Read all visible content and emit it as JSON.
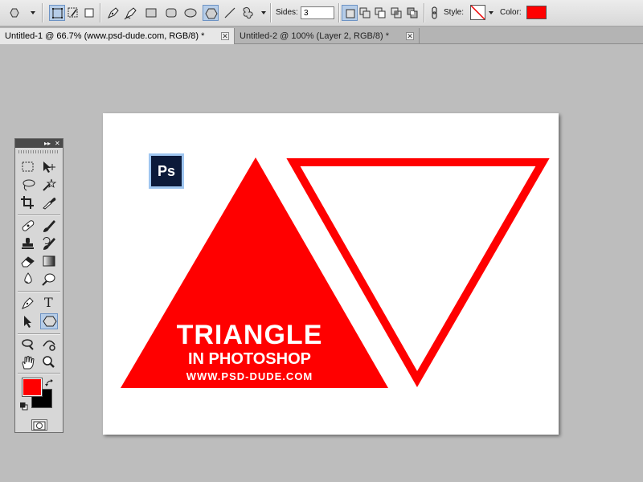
{
  "options_bar": {
    "sides_label": "Sides:",
    "sides_value": "3",
    "style_label": "Style:",
    "color_label": "Color:",
    "color_value": "#ff0000"
  },
  "tabs": [
    {
      "label": "Untitled-1 @ 66.7% (www.psd-dude.com, RGB/8) *",
      "active": true
    },
    {
      "label": "Untitled-2 @ 100% (Layer 2, RGB/8) *",
      "active": false
    }
  ],
  "canvas": {
    "logo_text": "Ps",
    "title": "TRIANGLE",
    "subtitle": "IN PHOTOSHOP",
    "url": "WWW.PSD-DUDE.COM",
    "accent": "#ff0000"
  },
  "tools": {
    "foreground_color": "#ff0000",
    "background_color": "#000000",
    "type_tool_glyph": "T"
  },
  "icons": {
    "close": "✕",
    "collapse": "▸▸"
  }
}
